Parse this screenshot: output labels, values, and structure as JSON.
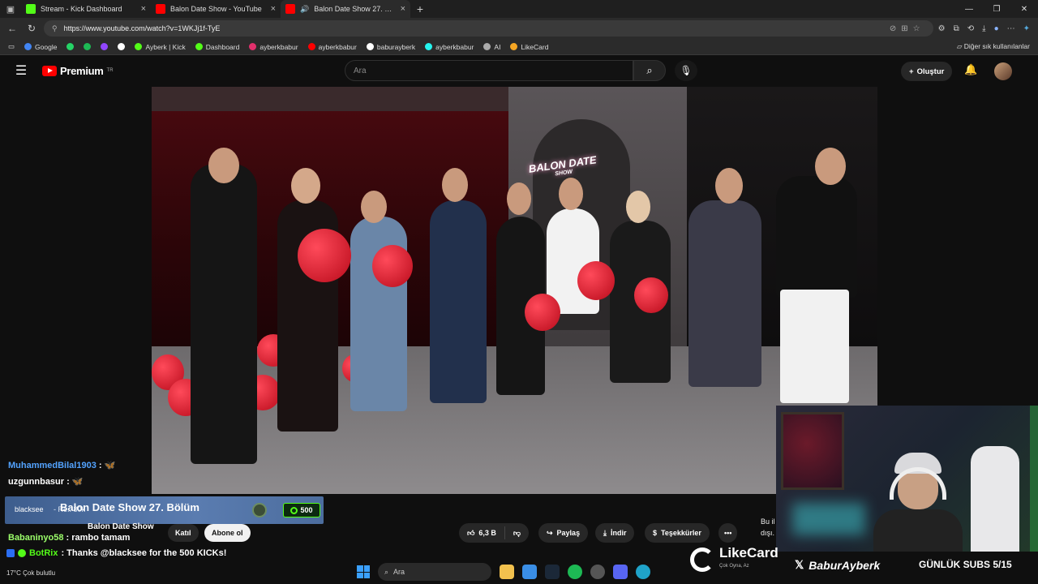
{
  "browser": {
    "tabs": [
      {
        "label": "Stream - Kick Dashboard",
        "color": "#53fc18",
        "active": false
      },
      {
        "label": "Balon Date Show - YouTube",
        "color": "#ff0000",
        "active": false
      },
      {
        "label": "Balon Date Show 27. Bölüm",
        "color": "#ff0000",
        "active": true
      }
    ],
    "url": "https://www.youtube.com/watch?v=1WKJj1f-TyE",
    "bookmarks": [
      {
        "label": "Google",
        "color": "#4285f4"
      },
      {
        "label": "",
        "color": "#25d366"
      },
      {
        "label": "",
        "color": "#1db954"
      },
      {
        "label": "",
        "color": "#9146ff"
      },
      {
        "label": "",
        "color": "#ffffff"
      },
      {
        "label": "Ayberk | Kick",
        "color": "#53fc18"
      },
      {
        "label": "Dashboard",
        "color": "#53fc18"
      },
      {
        "label": "ayberkbabur",
        "color": "#e1306c"
      },
      {
        "label": "ayberkbabur",
        "color": "#ff0000"
      },
      {
        "label": "baburayberk",
        "color": "#ffffff"
      },
      {
        "label": "ayberkbabur",
        "color": "#25f4ee"
      },
      {
        "label": "AI",
        "color": "#aaaaaa"
      },
      {
        "label": "LikeCard",
        "color": "#f5a623"
      }
    ],
    "bookmarks_other": "Diğer sık kullanılanlar"
  },
  "youtube": {
    "brand": "Premium",
    "region": "TR",
    "search_placeholder": "Ara",
    "create_label": "Oluştur",
    "video": {
      "neon_title": "BALON DATE",
      "neon_sub": "SHOW"
    },
    "channel": "Balon Date Show",
    "join_label": "Katıl",
    "subscribe_label": "Abone ol",
    "likes": "6,3 B",
    "share_label": "Paylaş",
    "download_label": "İndir",
    "thanks_label": "Teşekkürler",
    "side_info": [
      "Bu il",
      "dışı."
    ]
  },
  "chat": {
    "messages": [
      {
        "user": "MuhammedBilal1903",
        "text": ":",
        "emote": "🦋",
        "blue": true
      },
      {
        "user": "uzgunnbasur",
        "text": ":",
        "emote": "🦋",
        "blue": false
      }
    ],
    "kick_sub": {
      "user": "blacksee",
      "rest": "- Re.. 80k",
      "amount": "500"
    },
    "video_title": "Balon Date Show 27. Bölüm",
    "babaninyo": {
      "user": "Babaninyo58",
      "text": ": rambo tamam"
    },
    "botrix": {
      "user": "BotRix",
      "text": ": Thanks @blacksee for the 500 KICKs!"
    }
  },
  "overlay": {
    "likecard": "LikeCard",
    "likecard_tagline": "Çok Oyna, Az",
    "x_handle": "BaburAyberk",
    "subs_goal": "GÜNLÜK SUBS 5/15"
  },
  "taskbar": {
    "search_placeholder": "Ara",
    "weather_temp": "17°C",
    "weather_desc": "Çok bulutlu"
  }
}
